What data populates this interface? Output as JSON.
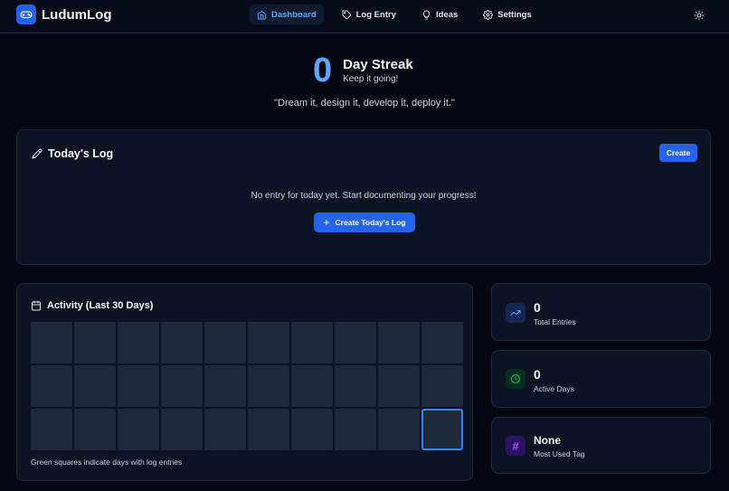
{
  "app": {
    "title": "LudumLog"
  },
  "nav": [
    {
      "label": "Dashboard",
      "icon": "home-icon",
      "active": true
    },
    {
      "label": "Log Entry",
      "icon": "tag-icon",
      "active": false
    },
    {
      "label": "Ideas",
      "icon": "lightbulb-icon",
      "active": false
    },
    {
      "label": "Settings",
      "icon": "gear-icon",
      "active": false
    }
  ],
  "streak": {
    "count": "0",
    "title": "Day Streak",
    "subtitle": "Keep it going!"
  },
  "quote": "\"Dream it, design it, develop it, deploy it.\"",
  "today_log": {
    "title": "Today's Log",
    "create_label": "Create",
    "empty_message": "No entry for today yet. Start documenting your progress!",
    "create_today_label": "Create Today's Log"
  },
  "activity": {
    "title": "Activity (Last 30 Days)",
    "note": "Green squares indicate days with log entries",
    "days": 30,
    "active_days": [],
    "today_index": 29
  },
  "stats": [
    {
      "value": "0",
      "label": "Total Entries",
      "icon": "trending-up-icon"
    },
    {
      "value": "0",
      "label": "Active Days",
      "icon": "clock-icon"
    },
    {
      "value": "None",
      "label": "Most Used Tag",
      "icon": "hash-icon"
    }
  ],
  "colors": {
    "accent": "#2563eb",
    "accent_light": "#60a5fa",
    "background": "#030712",
    "card": "#0c1424",
    "cell_empty": "#1e293b",
    "stat_green": "#22c55e",
    "stat_purple": "#a855f7"
  }
}
